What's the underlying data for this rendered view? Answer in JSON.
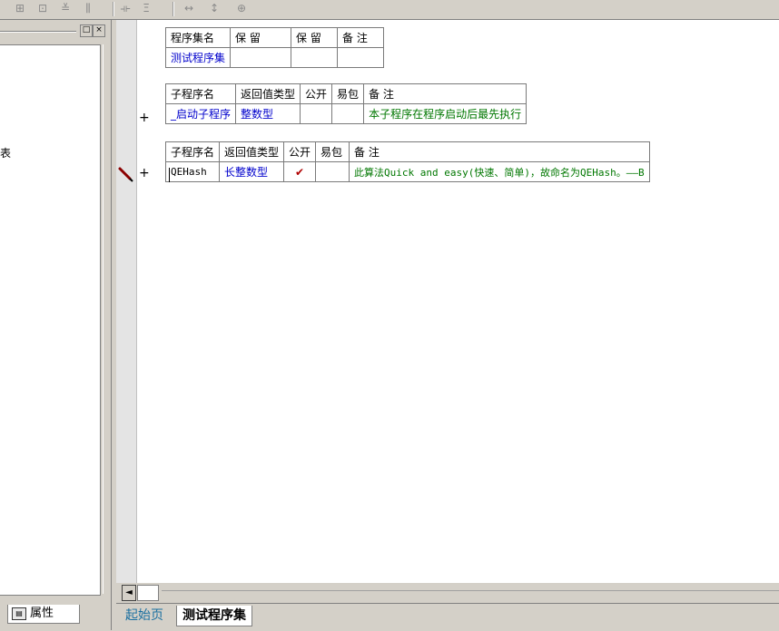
{
  "toolbar": {
    "buttons": [
      "align-left-icon",
      "align-center-icon",
      "align-right-icon",
      "align-justify-icon",
      "space-horizontal-icon",
      "space-vertical-icon",
      "width-icon",
      "height-icon",
      "size-icon"
    ]
  },
  "left_panel": {
    "partial_text": "表",
    "controls": {
      "restore": "□",
      "close": "×"
    }
  },
  "bottom_left": {
    "properties_tab": "属性"
  },
  "assembly_table": {
    "headers": [
      "程序集名",
      "保 留",
      "保 留",
      "备 注"
    ],
    "row": [
      "测试程序集",
      "",
      "",
      ""
    ]
  },
  "sub1_table": {
    "headers": [
      "子程序名",
      "返回值类型",
      "公开",
      "易包",
      "备 注"
    ],
    "row": [
      "_启动子程序",
      "整数型",
      "",
      "",
      "本子程序在程序启动后最先执行"
    ]
  },
  "sub2_table": {
    "headers": [
      "子程序名",
      "返回值类型",
      "公开",
      "易包",
      "备 注"
    ],
    "row": [
      "QEHash",
      "长整数型",
      "✔",
      "",
      "此算法Quick and easy(快速、简单)，故命名为QEHash。——B"
    ]
  },
  "gutter": {
    "plus": "+"
  },
  "hscroll": {
    "left_arrow": "◄"
  },
  "tabs": [
    "起始页",
    "测试程序集"
  ],
  "colors": {
    "link": "#0000cc",
    "comment": "#007700",
    "check": "#b00000",
    "tab_start": "#1a6fa0"
  }
}
